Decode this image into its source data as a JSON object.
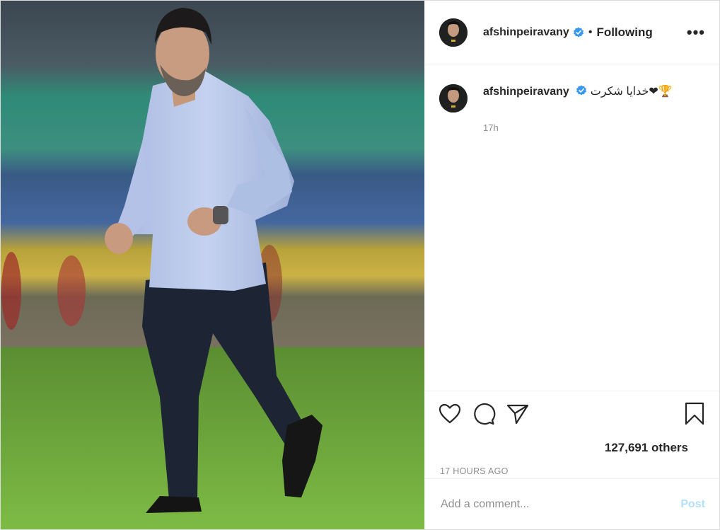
{
  "post": {
    "username": "afshinpeiravany",
    "separator": "•",
    "follow_status": "Following",
    "more_label": "•••",
    "caption": {
      "username": "afshinpeiravany",
      "text": "خدایا شکرت❤🏆",
      "time": "17h"
    },
    "likes_text": "127,691 others",
    "timestamp": "17 HOURS AGO",
    "comment_placeholder": "Add a comment...",
    "post_label": "Post"
  },
  "icons": {
    "like": "heart-icon",
    "comment": "comment-bubble-icon",
    "share": "paper-plane-icon",
    "save": "bookmark-icon",
    "verified": "verified-badge-icon",
    "more": "more-options-icon"
  },
  "colors": {
    "verified": "#3897f0",
    "post_button": "#b2dffc",
    "secondary_text": "#8e8e8e",
    "grass": "#5f9e2e"
  }
}
